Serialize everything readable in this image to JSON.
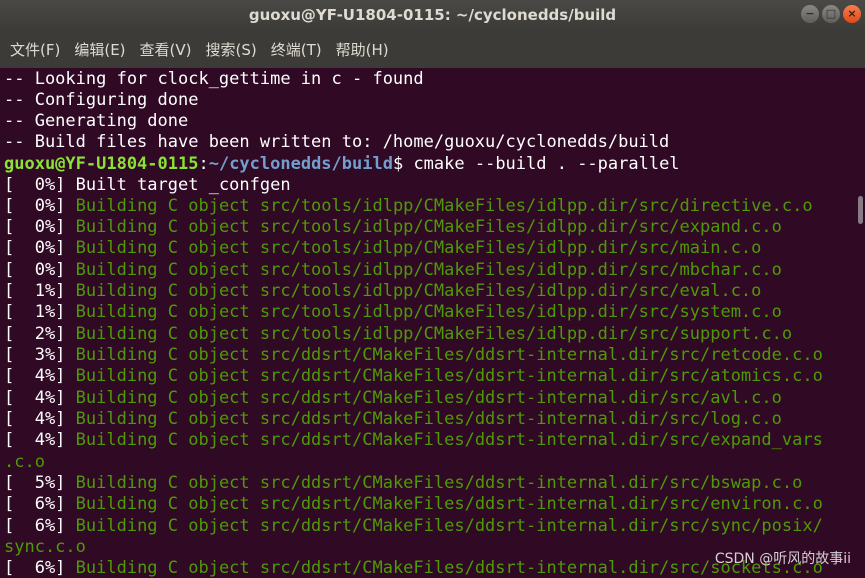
{
  "window": {
    "title": "guoxu@YF-U1804-0115: ~/cyclonedds/build",
    "buttons": {
      "minimize": "−",
      "maximize": "□",
      "close": "×"
    }
  },
  "menubar": {
    "items": [
      "文件(F)",
      "编辑(E)",
      "查看(V)",
      "搜索(S)",
      "终端(T)",
      "帮助(H)"
    ]
  },
  "terminal": {
    "output_before": [
      "-- Looking for clock_gettime in c - found",
      "-- Configuring done",
      "-- Generating done",
      "-- Build files have been written to: /home/guoxu/cyclonedds/build"
    ],
    "prompt": {
      "user_host": "guoxu@YF-U1804-0115",
      "path": "~/cyclonedds/build",
      "symbol": "$",
      "command": " cmake --build . --parallel"
    },
    "built_target": {
      "progress": "[  0%]",
      "text": " Built target _confgen"
    },
    "build_lines": [
      {
        "progress": "[  0%]",
        "text": " Building C object src/tools/idlpp/CMakeFiles/idlpp.dir/src/directive.c.o"
      },
      {
        "progress": "[  0%]",
        "text": " Building C object src/tools/idlpp/CMakeFiles/idlpp.dir/src/expand.c.o"
      },
      {
        "progress": "[  0%]",
        "text": " Building C object src/tools/idlpp/CMakeFiles/idlpp.dir/src/main.c.o"
      },
      {
        "progress": "[  0%]",
        "text": " Building C object src/tools/idlpp/CMakeFiles/idlpp.dir/src/mbchar.c.o"
      },
      {
        "progress": "[  1%]",
        "text": " Building C object src/tools/idlpp/CMakeFiles/idlpp.dir/src/eval.c.o"
      },
      {
        "progress": "[  1%]",
        "text": " Building C object src/tools/idlpp/CMakeFiles/idlpp.dir/src/system.c.o"
      },
      {
        "progress": "[  2%]",
        "text": " Building C object src/tools/idlpp/CMakeFiles/idlpp.dir/src/support.c.o"
      },
      {
        "progress": "[  3%]",
        "text": " Building C object src/ddsrt/CMakeFiles/ddsrt-internal.dir/src/retcode.c.o"
      },
      {
        "progress": "[  4%]",
        "text": " Building C object src/ddsrt/CMakeFiles/ddsrt-internal.dir/src/atomics.c.o"
      },
      {
        "progress": "[  4%]",
        "text": " Building C object src/ddsrt/CMakeFiles/ddsrt-internal.dir/src/avl.c.o"
      },
      {
        "progress": "[  4%]",
        "text": " Building C object src/ddsrt/CMakeFiles/ddsrt-internal.dir/src/log.c.o"
      },
      {
        "progress": "[  4%]",
        "text": " Building C object src/ddsrt/CMakeFiles/ddsrt-internal.dir/src/expand_vars",
        "wrap": ".c.o"
      },
      {
        "progress": "[  5%]",
        "text": " Building C object src/ddsrt/CMakeFiles/ddsrt-internal.dir/src/bswap.c.o"
      },
      {
        "progress": "[  6%]",
        "text": " Building C object src/ddsrt/CMakeFiles/ddsrt-internal.dir/src/environ.c.o"
      },
      {
        "progress": "[  6%]",
        "text": " Building C object src/ddsrt/CMakeFiles/ddsrt-internal.dir/src/sync/posix/",
        "wrap": "sync.c.o"
      },
      {
        "progress": "[  6%]",
        "text": " Building C object src/ddsrt/CMakeFiles/ddsrt-internal.dir/src/sockets.c.o"
      }
    ]
  },
  "watermark": "CSDN @听风的故事ii"
}
